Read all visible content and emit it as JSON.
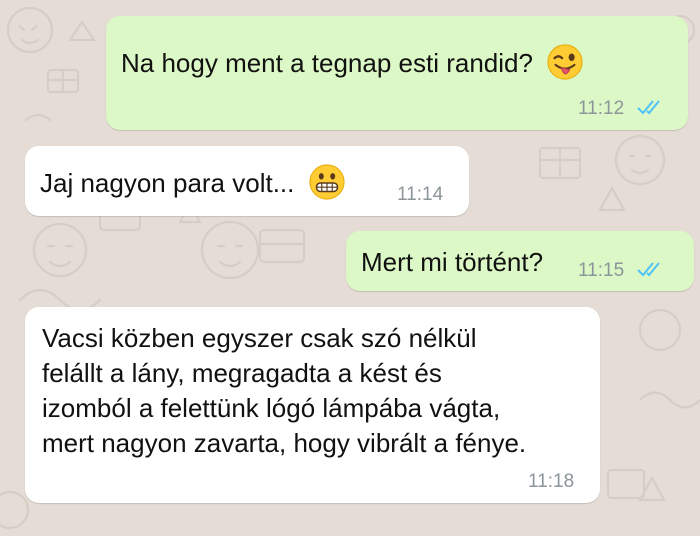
{
  "chat": {
    "wallpaper_color": "#e5ddd5",
    "outgoing_bubble_color": "#dcf8c6",
    "incoming_bubble_color": "#ffffff",
    "read_tick_color": "#4fc3f7",
    "messages": [
      {
        "direction": "outgoing",
        "text": "Na hogy ment a tegnap esti randid?",
        "emoji": "winking-face-with-tongue",
        "time": "11:12",
        "status": "read"
      },
      {
        "direction": "incoming",
        "text": "Jaj nagyon para volt...",
        "emoji": "grimacing-face",
        "time": "11:14"
      },
      {
        "direction": "outgoing",
        "text": "Mert mi történt?",
        "time": "11:15",
        "status": "read"
      },
      {
        "direction": "incoming",
        "lines": [
          "Vacsi közben egyszer csak szó nélkül",
          "felállt a lány, megragadta a kést és",
          "izomból a felettünk lógó lámpába vágta,",
          "mert nagyon zavarta, hogy vibrált a fénye."
        ],
        "time": "11:18"
      }
    ]
  }
}
